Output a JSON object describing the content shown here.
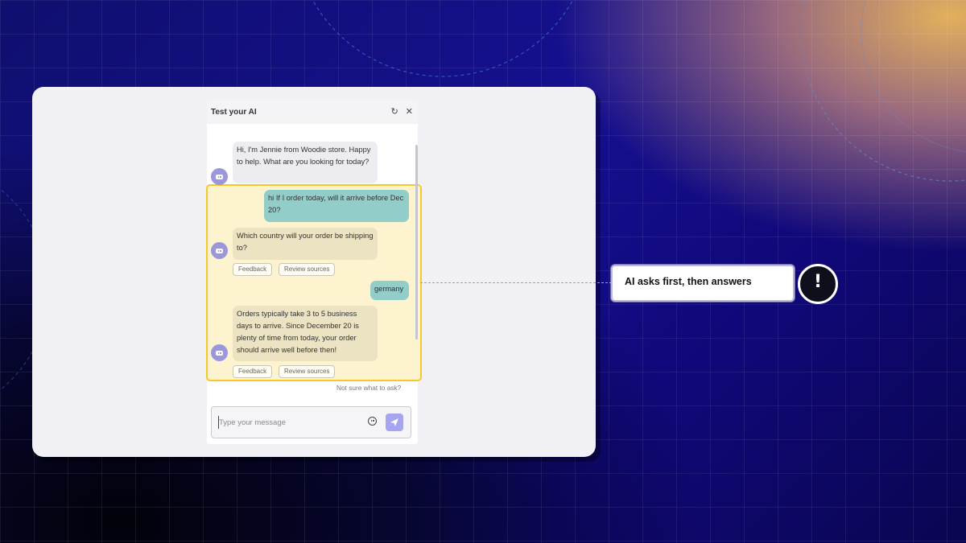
{
  "chat": {
    "title": "Test your AI",
    "icons": {
      "refresh": "refresh-icon",
      "close": "close-icon"
    },
    "messages": [
      {
        "role": "bot",
        "text": "Hi, I'm Jennie from Woodie store. Happy to help. What are you looking for today?"
      },
      {
        "role": "user",
        "text": "hi If I order today, will it arrive before Dec 20?"
      },
      {
        "role": "bot",
        "text": "Which country will your order be shipping to?",
        "actions": [
          "Feedback",
          "Review sources"
        ]
      },
      {
        "role": "user",
        "text": "germany"
      },
      {
        "role": "bot",
        "text": "Orders typically take 3 to 5 business days to arrive. Since December 20 is plenty of time from today, your order should arrive well before then!",
        "actions": [
          "Feedback",
          "Review sources"
        ]
      }
    ],
    "hint": "Not sure what to ask?",
    "input": {
      "placeholder": "Type your message",
      "value": ""
    }
  },
  "callout": {
    "text": "AI asks first, then answers",
    "badge": "!"
  },
  "colors": {
    "highlight_border": "#f5c92a",
    "highlight_fill": "#fdf3cf",
    "user_bubble": "#92cdc9",
    "bot_avatar": "#9b97db",
    "send_button": "#a6a6f0"
  }
}
